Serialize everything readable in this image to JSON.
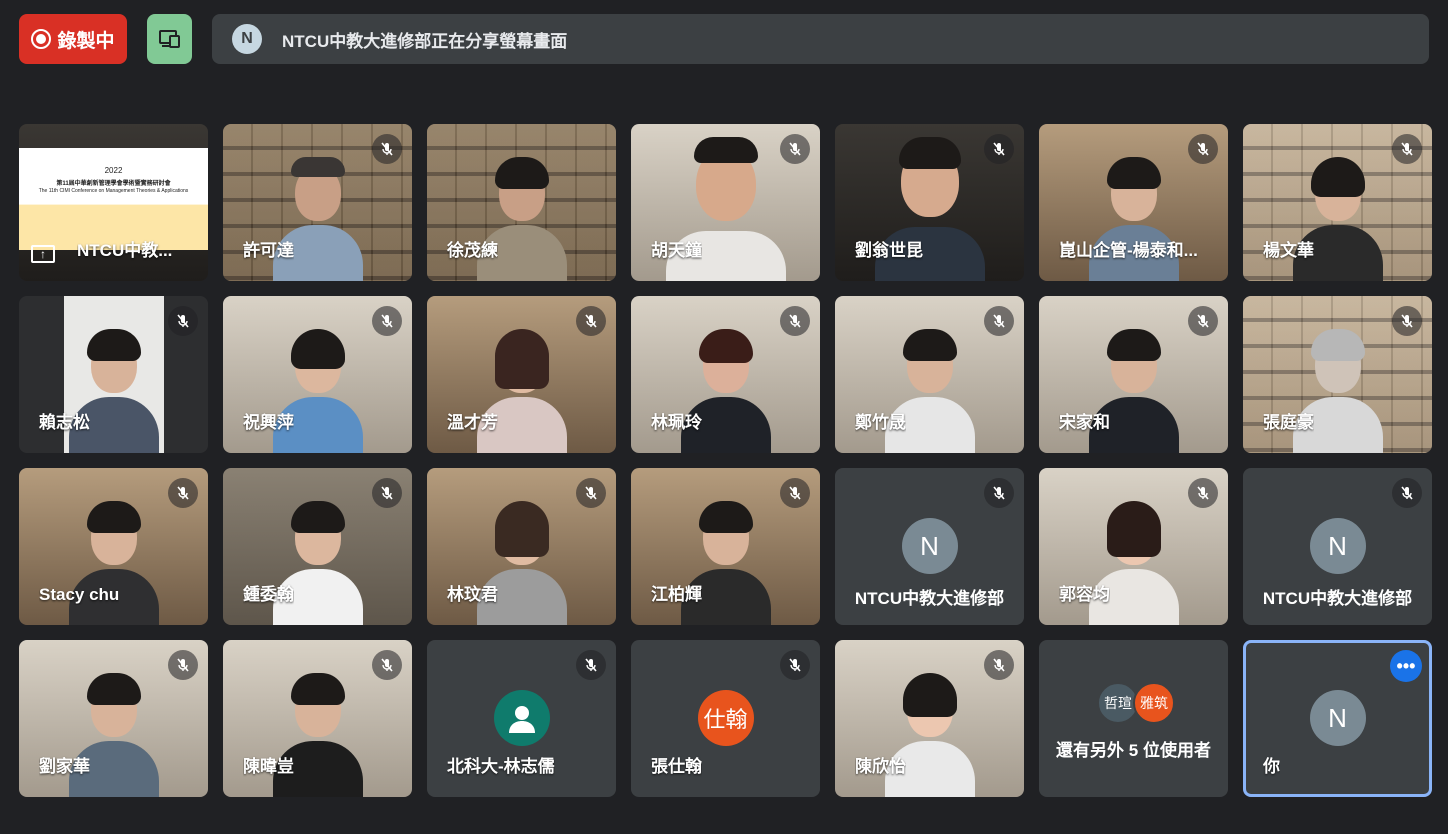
{
  "toolbar": {
    "record_label": "錄製中",
    "share_avatar_initial": "N",
    "share_banner_text": "NTCU中教大進修部正在分享螢幕畫面"
  },
  "presentation": {
    "name": "NTCU中教...",
    "slide_year": "2022",
    "slide_title": "第11屆中華創新管理學會學術暨實務研討會",
    "slide_subtitle": "The 11th CIMI Conference on Management Theories & Applications"
  },
  "participants": [
    {
      "name": "許可達",
      "muted": true
    },
    {
      "name": "徐茂練",
      "muted": false
    },
    {
      "name": "胡天鐘",
      "muted": true
    },
    {
      "name": "劉翁世昆",
      "muted": true
    },
    {
      "name": "崑山企管-楊泰和...",
      "muted": true
    },
    {
      "name": "楊文華",
      "muted": true
    },
    {
      "name": "賴志松",
      "muted": true
    },
    {
      "name": "祝興萍",
      "muted": true
    },
    {
      "name": "溫才芳",
      "muted": true
    },
    {
      "name": "林珮玲",
      "muted": true
    },
    {
      "name": "鄭竹晟",
      "muted": true
    },
    {
      "name": "宋家和",
      "muted": true
    },
    {
      "name": "張庭豪",
      "muted": true
    },
    {
      "name": "Stacy chu",
      "muted": true
    },
    {
      "name": "鍾委翰",
      "muted": true
    },
    {
      "name": "林玟君",
      "muted": true
    },
    {
      "name": "江柏輝",
      "muted": true
    },
    {
      "name": "NTCU中教大進修部",
      "initial": "N",
      "muted": true
    },
    {
      "name": "郭容均",
      "muted": true
    },
    {
      "name": "NTCU中教大進修部",
      "initial": "N",
      "muted": true
    },
    {
      "name": "劉家華",
      "muted": true
    },
    {
      "name": "陳暐豈",
      "muted": true
    },
    {
      "name": "北科大-林志儒",
      "muted": true
    },
    {
      "name": "張仕翰",
      "initial": "仕翰",
      "muted": true
    },
    {
      "name": "陳欣怡",
      "muted": true
    }
  ],
  "others": {
    "text": "還有另外 5 位使用者",
    "avatar_a": "哲瑄",
    "avatar_b": "雅筑"
  },
  "self": {
    "name": "你",
    "initial": "N"
  },
  "colors": {
    "record": "#d93025",
    "present": "#81c995",
    "self_border": "#8ab4f8",
    "more_button": "#1a73e8"
  },
  "icons": [
    "record-icon",
    "present-screen-icon",
    "mic-off-icon",
    "more-icon",
    "person-icon"
  ]
}
